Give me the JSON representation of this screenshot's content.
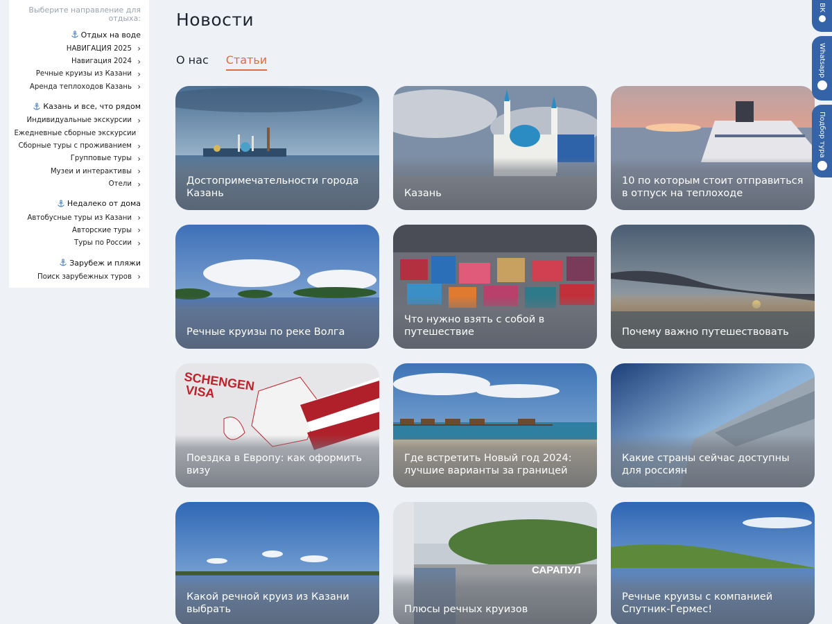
{
  "sidebar": {
    "hint": "Выберите направление для отдыха:",
    "groups": [
      {
        "title": "Отдых на воде",
        "icon": "anchor-icon",
        "links": [
          "НАВИГАЦИЯ 2025",
          "Навигация 2024",
          "Речные круизы из Казани",
          "Аренда теплоходов Казань"
        ]
      },
      {
        "title": "Казань и все, что рядом",
        "icon": "anchor-icon",
        "links": [
          "Индивидуальные экскурсии",
          "Ежедневные сборные экскурсии",
          "Сборные туры с проживанием",
          "Групповые туры",
          "Музеи и интерактивы",
          "Отели"
        ]
      },
      {
        "title": "Недалеко от дома",
        "icon": "anchor-icon",
        "links": [
          "Автобусные туры из Казани",
          "Авторские туры",
          "Туры по России"
        ]
      },
      {
        "title": "Зарубеж и пляжи",
        "icon": "anchor-icon",
        "links": [
          "Поиск зарубежных туров"
        ]
      }
    ]
  },
  "main": {
    "title": "Новости",
    "tabs": [
      {
        "label": "О нас",
        "active": false
      },
      {
        "label": "Статьи",
        "active": true
      }
    ],
    "cards": [
      {
        "title": "Достопримечательности города Казань",
        "image": "kazan-skyline-photo"
      },
      {
        "title": "Казань",
        "image": "kul-sharif-mosque-photo"
      },
      {
        "title": "10 по которым стоит отправиться в отпуск на теплоходе",
        "image": "cruise-ship-sunset-photo"
      },
      {
        "title": "Речные круизы по реке Волга",
        "image": "volga-river-photo"
      },
      {
        "title": "Что нужно взять с собой в путешествие",
        "image": "luggage-pile-photo"
      },
      {
        "title": "Почему важно путешествовать",
        "image": "sunset-horizon-photo"
      },
      {
        "title": "Поездка в Европу: как оформить визу",
        "image": "schengen-visa-map-photo"
      },
      {
        "title": "Где встретить Новый год 2024: лучшие варианты за границей",
        "image": "overwater-bungalows-photo"
      },
      {
        "title": "Какие страны сейчас доступны для россиян",
        "image": "airplane-window-photo"
      },
      {
        "title": "Какой речной круиз из Казани выбрать",
        "image": "river-landscape-photo"
      },
      {
        "title": "Плюсы речных круизов",
        "image": "sarapul-pier-photo"
      },
      {
        "title": "Речные круизы с компанией Спутник-Гермес!",
        "image": "green-riverbank-photo"
      }
    ]
  },
  "float_tabs": {
    "vk": "ВК",
    "whatsapp": "Whatsapp",
    "tour": "Подбор тура"
  },
  "colors": {
    "accent": "#e0693e",
    "float_blue": "#3563a8",
    "background": "#eef2f7"
  }
}
